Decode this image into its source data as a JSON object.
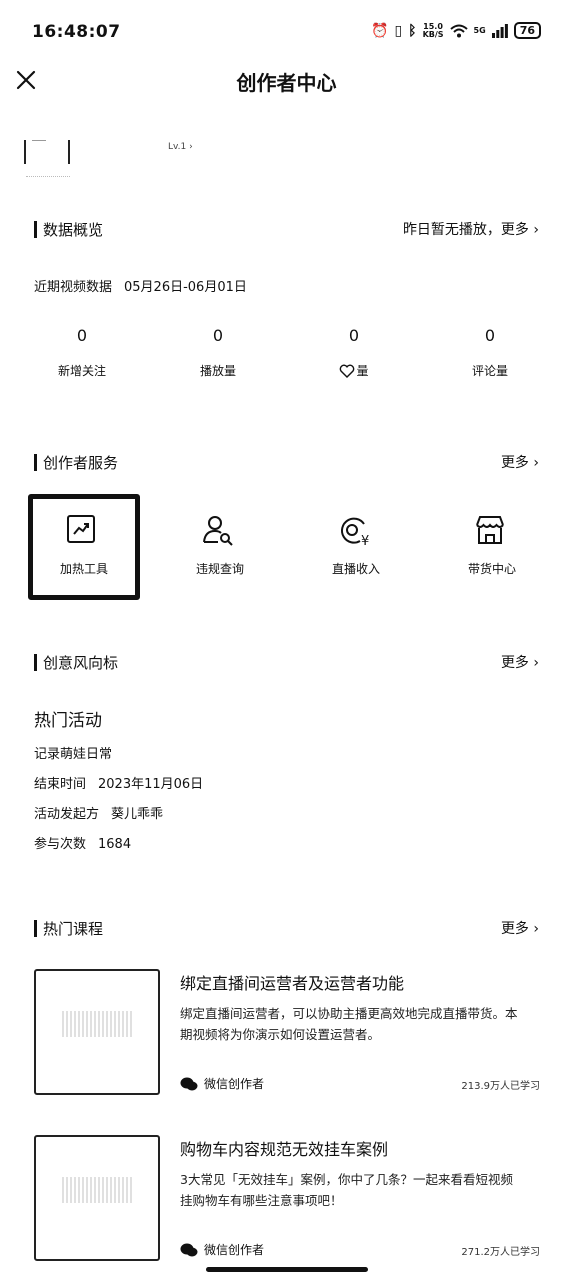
{
  "status_bar": {
    "time": "16:48:07",
    "net_speed_top": "15.0",
    "net_speed_unit": "KB/S",
    "network": "5G",
    "battery": "76"
  },
  "header": {
    "title": "创作者中心"
  },
  "profile": {
    "level": "Lv.1"
  },
  "data_overview": {
    "title": "数据概览",
    "more": "昨日暂无播放，更多",
    "recent_label": "近期视频数据",
    "date_range": "05月26日-06月01日",
    "stats": [
      {
        "value": "0",
        "label": "新增关注"
      },
      {
        "value": "0",
        "label": "播放量"
      },
      {
        "value": "0",
        "label": "量"
      },
      {
        "value": "0",
        "label": "评论量"
      }
    ]
  },
  "services": {
    "title": "创作者服务",
    "more": "更多",
    "items": [
      {
        "label": "加热工具",
        "icon": "trend-chart-icon"
      },
      {
        "label": "违规查询",
        "icon": "user-search-icon"
      },
      {
        "label": "直播收入",
        "icon": "live-income-icon"
      },
      {
        "label": "带货中心",
        "icon": "store-icon"
      }
    ]
  },
  "trends": {
    "title": "创意风向标",
    "more": "更多",
    "activity_heading": "热门活动",
    "activity_name": "记录萌娃日常",
    "end_label": "结束时间",
    "end_value": "2023年11月06日",
    "organizer_label": "活动发起方",
    "organizer_value": "葵儿乖乖",
    "participation_label": "参与次数",
    "participation_value": "1684"
  },
  "courses": {
    "title": "热门课程",
    "more": "更多",
    "items": [
      {
        "title": "绑定直播间运营者及运营者功能",
        "desc": "绑定直播间运营者，可以协助主播更高效地完成直播带货。本期视频将为你演示如何设置运营者。",
        "author": "微信创作者",
        "learners": "213.9万人已学习"
      },
      {
        "title": "购物车内容规范无效挂车案例",
        "desc": "3大常见「无效挂车」案例，你中了几条？一起来看看短视频挂购物车有哪些注意事项吧！",
        "author": "微信创作者",
        "learners": "271.2万人已学习"
      }
    ]
  }
}
